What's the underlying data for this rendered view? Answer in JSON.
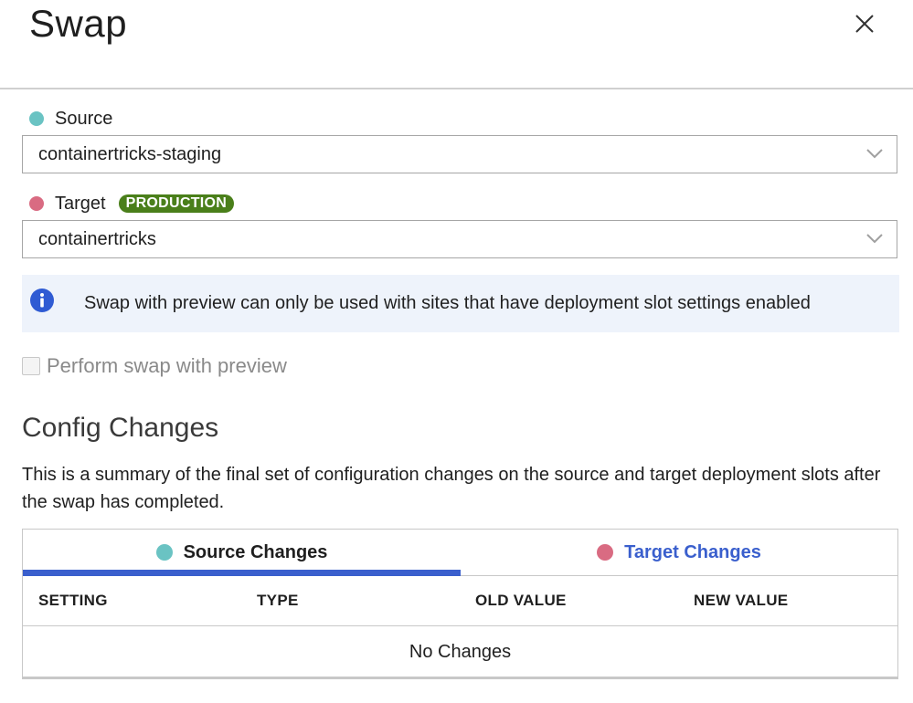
{
  "dialog": {
    "title": "Swap"
  },
  "source": {
    "label": "Source",
    "selected": "containertricks-staging",
    "color": "#6ac3c3"
  },
  "target": {
    "label": "Target",
    "badge": "PRODUCTION",
    "selected": "containertricks",
    "color": "#d96b82"
  },
  "info": {
    "icon": "info-icon",
    "message": "Swap with preview can only be used with sites that have deployment slot settings enabled"
  },
  "preview": {
    "label": "Perform swap with preview",
    "checked": false,
    "disabled": true
  },
  "config": {
    "title": "Config Changes",
    "description": "This is a summary of the final set of configuration changes on the source and target deployment slots after the swap has completed.",
    "tabs": [
      {
        "label": "Source Changes",
        "active": true
      },
      {
        "label": "Target Changes",
        "active": false
      }
    ],
    "columns": [
      "SETTING",
      "TYPE",
      "OLD VALUE",
      "NEW VALUE"
    ],
    "empty_message": "No Changes"
  },
  "colors": {
    "accent": "#3a5fcd",
    "badge": "#4a7f1a"
  }
}
